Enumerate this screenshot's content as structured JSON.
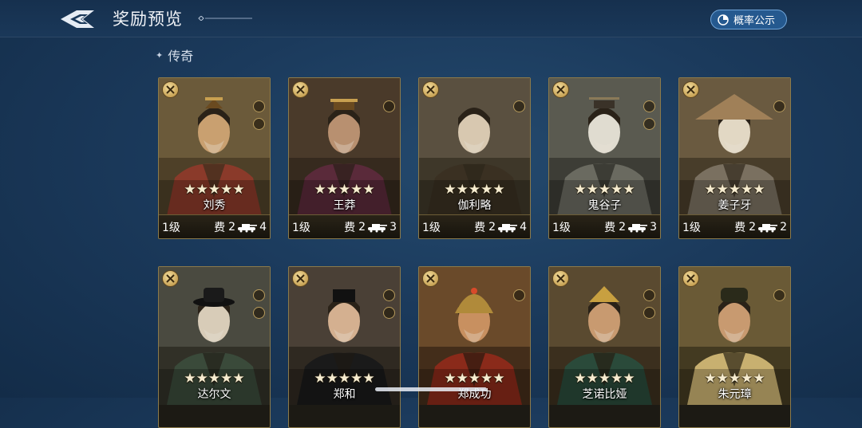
{
  "header": {
    "title": "奖励预览",
    "probability_button": "概率公示"
  },
  "section": {
    "label": "传奇"
  },
  "cards_row1": [
    {
      "name": "刘秀",
      "level": "1级",
      "cost_label": "费",
      "cost": "2",
      "troops": "4",
      "stars": "★★★★★"
    },
    {
      "name": "王莽",
      "level": "1级",
      "cost_label": "费",
      "cost": "2",
      "troops": "3",
      "stars": "★★★★★"
    },
    {
      "name": "伽利略",
      "level": "1级",
      "cost_label": "费",
      "cost": "2",
      "troops": "4",
      "stars": "★★★★★"
    },
    {
      "name": "鬼谷子",
      "level": "1级",
      "cost_label": "费",
      "cost": "2",
      "troops": "3",
      "stars": "★★★★★"
    },
    {
      "name": "姜子牙",
      "level": "1级",
      "cost_label": "费",
      "cost": "2",
      "troops": "2",
      "stars": "★★★★★"
    }
  ],
  "cards_row2": [
    {
      "name": "达尔文",
      "stars": "★★★★★"
    },
    {
      "name": "郑和",
      "stars": "★★★★★"
    },
    {
      "name": "郑成功",
      "stars": "★★★★★"
    },
    {
      "name": "芝诺比娅",
      "stars": "★★★★★"
    },
    {
      "name": "朱元璋",
      "stars": "★★★★★"
    }
  ],
  "colors": {
    "background": "#1b3a5c",
    "card_border": "#8c7a4a",
    "badge_gold": "#c9a457",
    "prob_button": "#25598f"
  }
}
